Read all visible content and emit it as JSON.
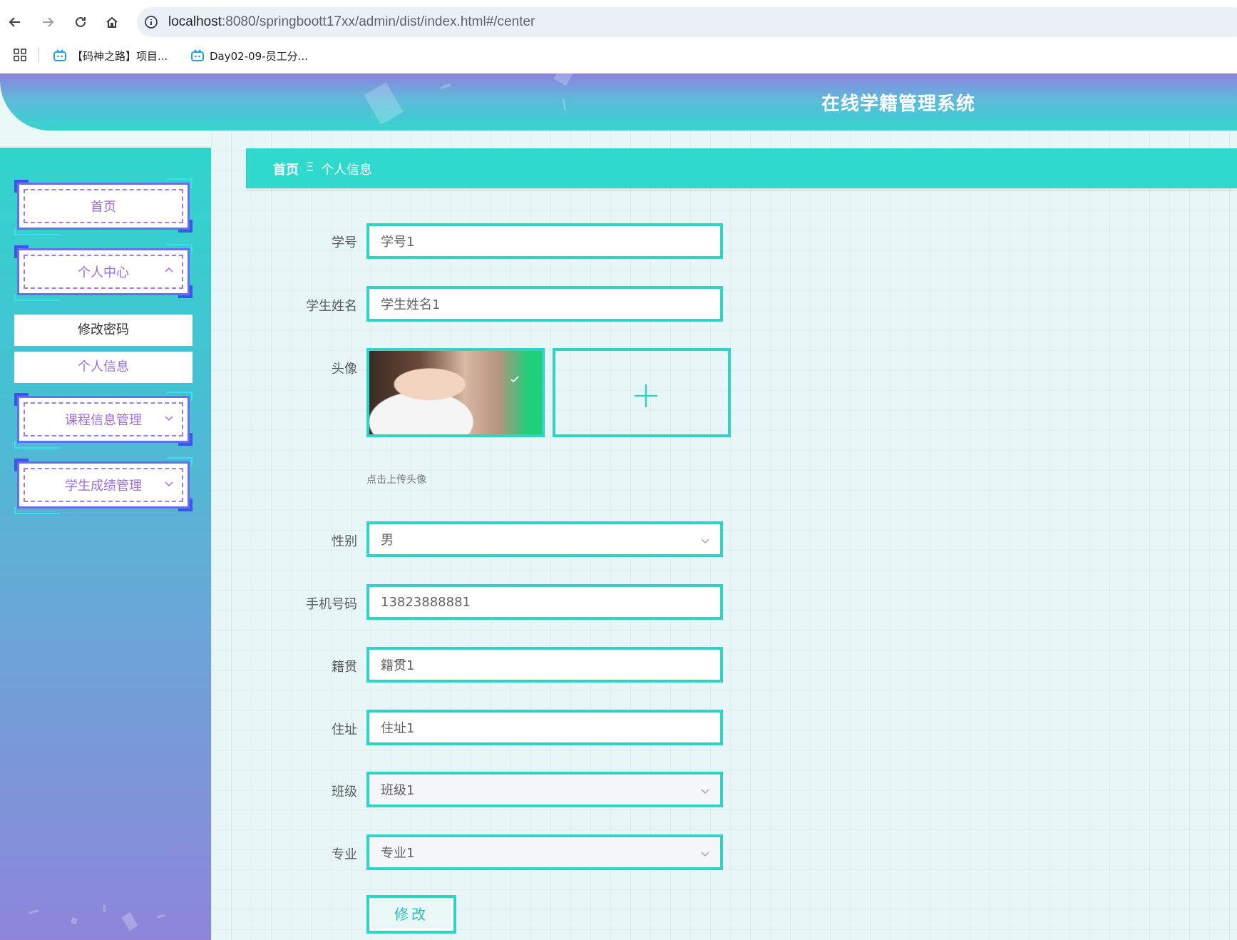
{
  "browser": {
    "url_host": "localhost",
    "url_path": ":8080/springboott17xx/admin/dist/index.html#/center",
    "bookmarks": [
      "【码神之路】项目...",
      "Day02-09-员工分..."
    ]
  },
  "header": {
    "title": "在线学籍管理系统"
  },
  "sidebar": {
    "items": [
      {
        "label": "首页"
      },
      {
        "label": "个人中心",
        "expanded": true,
        "children": [
          {
            "label": "修改密码"
          },
          {
            "label": "个人信息"
          }
        ]
      },
      {
        "label": "课程信息管理",
        "expanded": false
      },
      {
        "label": "学生成绩管理",
        "expanded": false
      }
    ]
  },
  "breadcrumb": {
    "home": "首页",
    "separator": "Ξ",
    "current": "个人信息"
  },
  "form": {
    "fields": {
      "student_no": {
        "label": "学号",
        "value": "学号1"
      },
      "student_name": {
        "label": "学生姓名",
        "value": "学生姓名1"
      },
      "avatar": {
        "label": "头像",
        "tip": "点击上传头像"
      },
      "gender": {
        "label": "性别",
        "value": "男"
      },
      "phone": {
        "label": "手机号码",
        "value": "13823888881"
      },
      "native_place": {
        "label": "籍贯",
        "value": "籍贯1"
      },
      "address": {
        "label": "住址",
        "value": "住址1"
      },
      "class": {
        "label": "班级",
        "value": "班级1"
      },
      "major": {
        "label": "专业",
        "value": "专业1"
      }
    },
    "submit_label": "修改"
  },
  "colors": {
    "accent": "#2fd4c6",
    "menu_text": "#9b6ee0",
    "header_top": "#8e80de"
  },
  "icons": [
    "back-icon",
    "forward-icon",
    "reload-icon",
    "home-icon",
    "info-icon",
    "apps-icon",
    "bilibili-icon",
    "chevron-up-icon",
    "chevron-down-icon",
    "check-icon",
    "plus-icon"
  ]
}
